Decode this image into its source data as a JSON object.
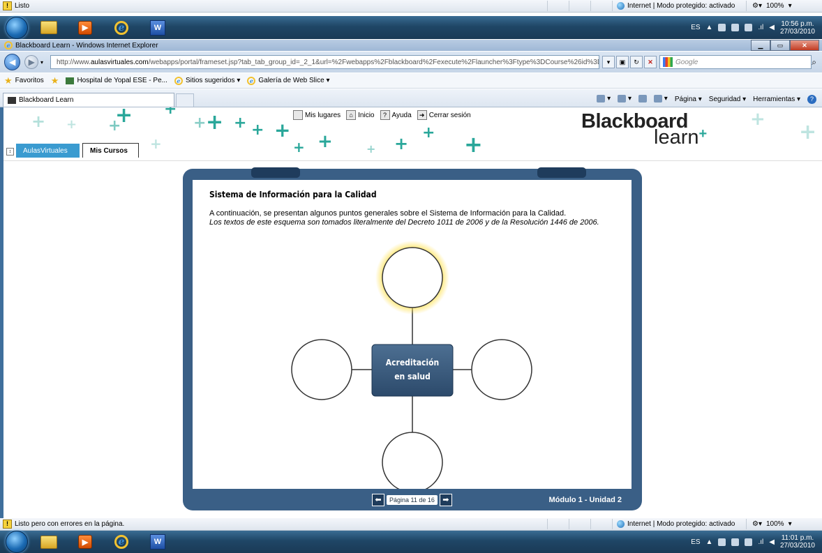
{
  "top_status": {
    "text": "Listo",
    "zone": "Internet | Modo protegido: activado",
    "zoom": "100%"
  },
  "top_taskbar": {
    "lang": "ES",
    "time": "10:56 p.m.",
    "date": "27/03/2010"
  },
  "window": {
    "title": "Blackboard Learn - Windows Internet Explorer"
  },
  "address": {
    "prefix": "http://www.",
    "domain": "aulasvirtuales.com",
    "path": "/webapps/portal/frameset.jsp?tab_tab_group_id=_2_1&url=%2Fwebapps%2Fblackboard%2Fexecute%2Flauncher%3Ftype%3DCourse%26id%3D_1(",
    "search_placeholder": "Google"
  },
  "favorites": {
    "label": "Favoritos",
    "items": [
      "Hospital de Yopal ESE - Pe...",
      "Sitios sugeridos ▾",
      "Galería de Web Slice ▾"
    ]
  },
  "tab": {
    "label": "Blackboard Learn"
  },
  "commandbar": {
    "page": "Página ▾",
    "security": "Seguridad ▾",
    "tools": "Herramientas ▾"
  },
  "bb": {
    "toplinks": {
      "places": "Mis lugares",
      "home": "Inicio",
      "help": "Ayuda",
      "logout": "Cerrar sesión"
    },
    "logo_line1": "Blackboard",
    "logo_line2": "learn",
    "tabs": [
      "AulasVirtuales",
      "Mis Cursos"
    ]
  },
  "slide": {
    "title": "Sistema de Información para la Calidad",
    "intro": "A continuación, se presentan algunos puntos generales sobre el Sistema de Información para la Calidad.",
    "intro_italic": "Los textos de este esquema son tomados literalmente del Decreto 1011 de 2006 y de la Resolución 1446 de 2006.",
    "center_line1": "Acreditación",
    "center_line2": "en salud",
    "page_label": "Página 11 de 16",
    "module": "Módulo 1 - Unidad 2"
  },
  "bottom_status": {
    "text": "Listo pero con errores en la página.",
    "zone": "Internet | Modo protegido: activado",
    "zoom": "100%"
  },
  "bottom_taskbar": {
    "lang": "ES",
    "time": "11:01 p.m.",
    "date": "27/03/2010"
  }
}
